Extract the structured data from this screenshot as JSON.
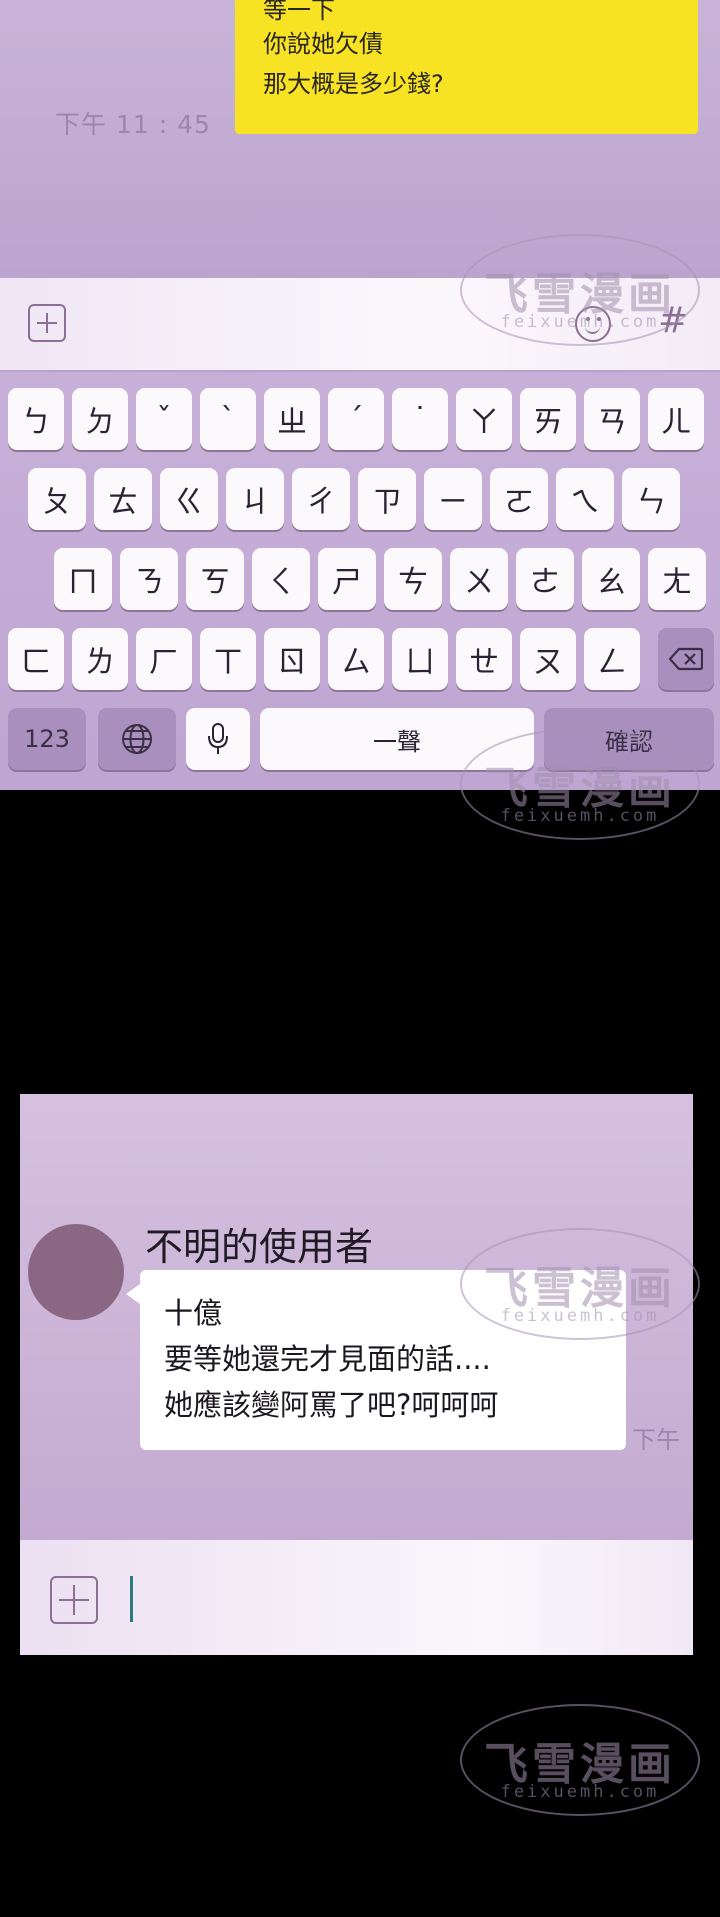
{
  "panel1": {
    "outgoing_lines": [
      "等一下",
      "你說她欠債",
      "那大概是多少錢?"
    ],
    "time": "下午 11 : 45",
    "hash_symbol": "#",
    "keyboard": {
      "row1": [
        "ㄅ",
        "ㄉ",
        "ˇ",
        "ˋ",
        "ㄓ",
        "ˊ",
        "˙",
        "ㄚ",
        "ㄞ",
        "ㄢ",
        "ㄦ"
      ],
      "row2": [
        "ㄆ",
        "ㄊ",
        "ㄍ",
        "ㄐ",
        "ㄔ",
        "ㄗ",
        "ㄧ",
        "ㄛ",
        "ㄟ",
        "ㄣ"
      ],
      "row3": [
        "ㄇ",
        "ㄋ",
        "ㄎ",
        "ㄑ",
        "ㄕ",
        "ㄘ",
        "ㄨ",
        "ㄜ",
        "ㄠ",
        "ㄤ"
      ],
      "row4": [
        "ㄈ",
        "ㄌ",
        "ㄏ",
        "ㄒ",
        "ㄖ",
        "ㄙ",
        "ㄩ",
        "ㄝ",
        "ㄡ",
        "ㄥ"
      ],
      "numbers_label": "123",
      "space_label": "一聲",
      "confirm_label": "確認"
    }
  },
  "panel2": {
    "sender_name": "不明的使用者",
    "message_lines": [
      "十億",
      "要等她還完才見面的話....",
      "她應該變阿罵了吧?呵呵呵"
    ],
    "time": "下午"
  },
  "watermark": {
    "title": "飞雪漫画",
    "url": "feixuemh.com"
  },
  "colors": {
    "outgoing_bubble": "#f7e224",
    "chat_bg": "#c9b4d8",
    "icon": "#8c6f95",
    "cursor": "#2d7a7a"
  }
}
